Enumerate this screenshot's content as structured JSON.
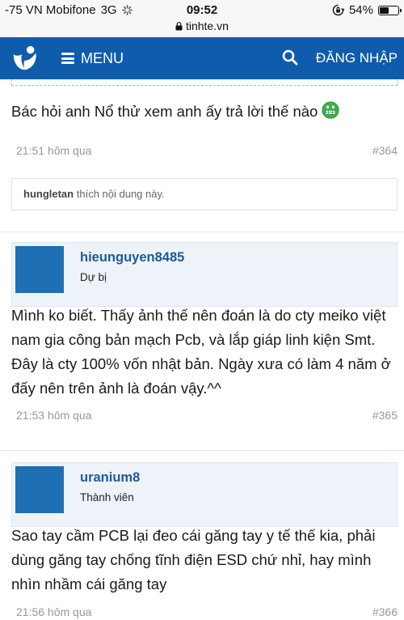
{
  "statusbar": {
    "carrier": "-75 VN Mobifone",
    "network": "3G",
    "time": "09:52",
    "battery": "54%",
    "battery_level": 0.54,
    "url": "tinhte.vn"
  },
  "header": {
    "menu_label": "MENU",
    "login_label": "ĐĂNG NHẬP",
    "brand_color": "#0f5cad"
  },
  "posts": [
    {
      "message": "Bác hỏi anh Nổ thử xem anh ấy trả lời thế nào",
      "time": "21:51 hôm qua",
      "number": "#364",
      "likes": {
        "user": "hungletan",
        "text": "thích nội dung này."
      }
    },
    {
      "username": "hieunguyen8485",
      "role": "Dự bị",
      "message_lines": [
        "Mình ko biết. Thấy ảnh thế nên đoán là do cty meiko việt",
        "nam gia công bản mạch Pcb, và lắp giáp linh kiện Smt.",
        "Đây là cty 100% vốn nhật bản. Ngày xưa có làm 4 năm ở",
        "đấy nên trên ảnh là đoán vậy.^^"
      ],
      "time": "21:53 hôm qua",
      "number": "#365"
    },
    {
      "username": "uranium8",
      "role": "Thành viên",
      "message_lines": [
        "Sao tay cầm PCB lại đeo cái găng tay y tế thế kia, phải",
        "dùng găng tay chống tĩnh điện ESD chứ nhỉ, hay mình",
        "nhìn nhầm cái găng tay"
      ],
      "time": "21:56 hôm qua",
      "number": "#366"
    }
  ]
}
